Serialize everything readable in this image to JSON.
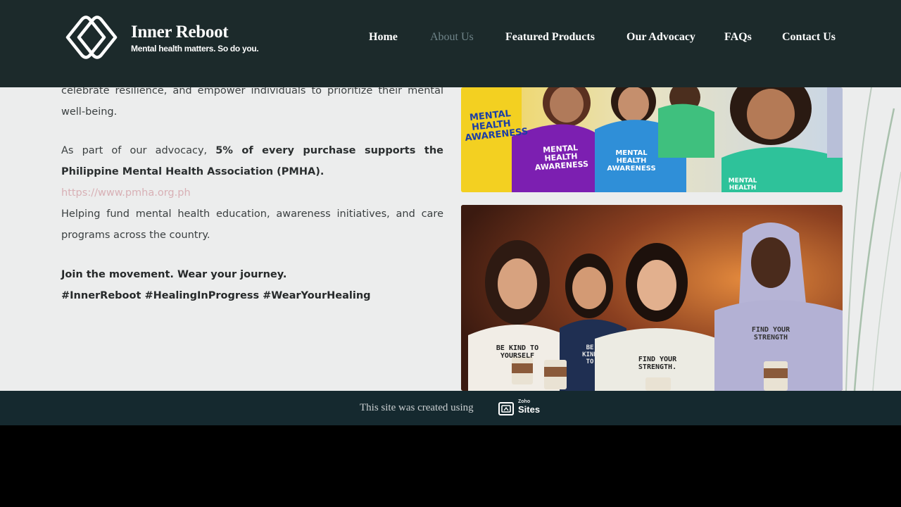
{
  "brand": {
    "title": "Inner Reboot",
    "tagline": "Mental health matters. So do you."
  },
  "nav": {
    "items": [
      {
        "label": "Home",
        "active": false
      },
      {
        "label": "About Us",
        "active": true
      },
      {
        "label": "Featured Products",
        "active": false
      },
      {
        "label": "Our Advocacy",
        "active": false
      },
      {
        "label": "FAQs",
        "active": false
      },
      {
        "label": "Contact Us",
        "active": false
      }
    ]
  },
  "content": {
    "intro_tail": "celebrate resilience, and empower individuals to prioritize their mental well-being.",
    "advocacy_lead": "As part of our advocacy,",
    "advocacy_bold": "5% of every purchase supports the Philippine Mental Health Association (PMHA).",
    "link": "https://www.pmha.org.ph",
    "helping": "Helping fund mental health education, awareness initiatives, and care programs across the country.",
    "join": "Join the movement. Wear your journey.",
    "hashtags": "#InnerReboot #HealingInProgress #WearYourHealing"
  },
  "photos": {
    "top_shirts": [
      "MENTAL HEALTH AWARENESS",
      "MENTAL HEALTH AWARENESS",
      "MENTAL HEALTH AWARENESS",
      "MENTAL HEALTH AWARENESS"
    ],
    "bottom_shirts": [
      "BE KIND TO YOURSELF",
      "BE KIND TO",
      "FIND YOUR STRENGTH.",
      "FIND YOUR STRENGTH"
    ]
  },
  "footer": {
    "created_text": "This site was created using",
    "zoho_small": "Zoho",
    "zoho_sites": "Sites"
  },
  "colors": {
    "header_bg": "#1c2a2b",
    "main_bg": "#eceded",
    "footer_bg": "#15292f",
    "link": "#d8b0b5",
    "nav_active": "#6f8489"
  }
}
